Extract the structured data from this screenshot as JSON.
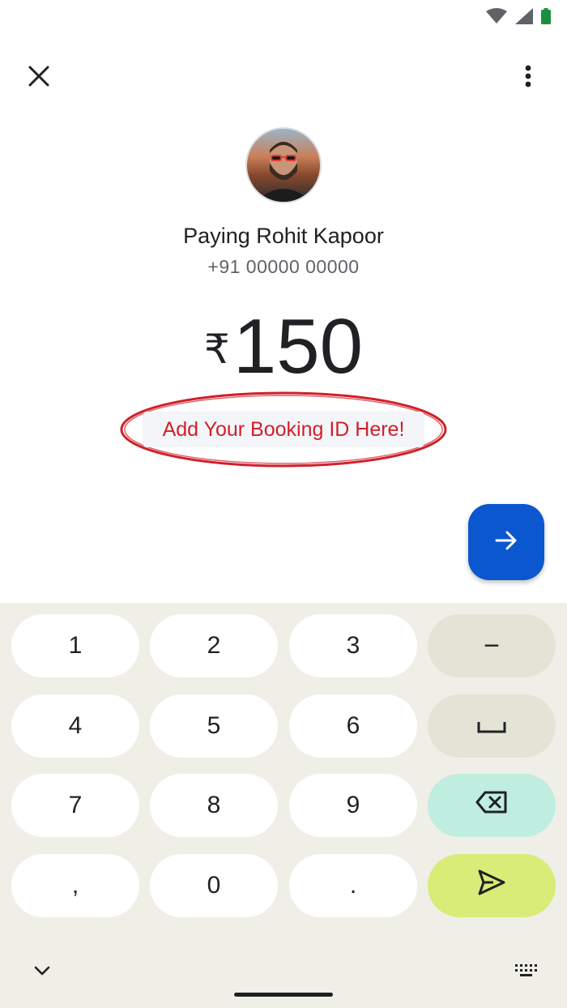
{
  "status_bar": {
    "icons": [
      "wifi-icon",
      "cell-signal-icon",
      "battery-icon"
    ],
    "battery_color": "#1e8e3e"
  },
  "top_bar": {
    "close_icon": "close-icon",
    "more_icon": "more-vert-icon"
  },
  "payee": {
    "title": "Paying Rohit Kapoor",
    "phone": "+91 00000 00000"
  },
  "amount": {
    "currency": "₹",
    "value": "150"
  },
  "note": {
    "placeholder": "Add Your Booking ID Here!",
    "highlight_color": "#d0202a"
  },
  "next_button": {
    "icon": "arrow-forward-icon",
    "color": "#0b57d0"
  },
  "keyboard": {
    "rows": [
      [
        "1",
        "2",
        "3",
        "−"
      ],
      [
        "4",
        "5",
        "6",
        "␣"
      ],
      [
        "7",
        "8",
        "9",
        "⌫"
      ],
      [
        ",",
        "0",
        ".",
        "➤"
      ]
    ],
    "collapse_icon": "chevron-down-icon",
    "switch_icon": "keyboard-icon"
  }
}
